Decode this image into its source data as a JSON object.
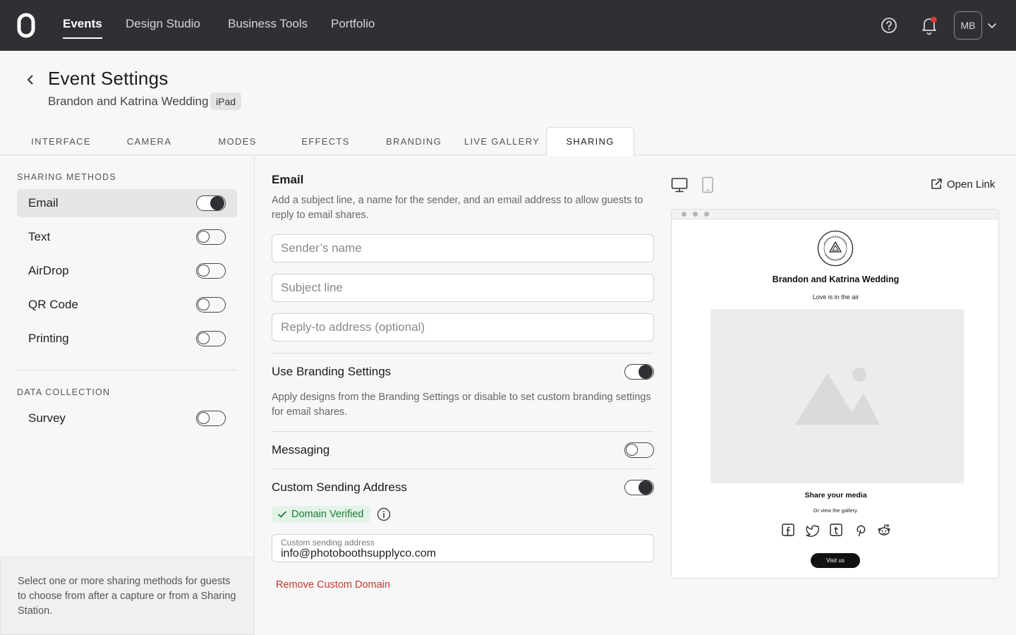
{
  "nav": {
    "items": [
      "Events",
      "Design Studio",
      "Business Tools",
      "Portfolio"
    ],
    "active": "Events",
    "avatar_initials": "MB"
  },
  "header": {
    "title": "Event Settings",
    "event_name": "Brandon and Katrina Wedding",
    "device_badge": "iPad"
  },
  "tabs": [
    "INTERFACE",
    "CAMERA",
    "MODES",
    "EFFECTS",
    "BRANDING",
    "LIVE GALLERY",
    "SHARING"
  ],
  "active_tab": "SHARING",
  "sidebar": {
    "sharing_label": "SHARING METHODS",
    "methods": [
      {
        "label": "Email",
        "on": true,
        "selected": true
      },
      {
        "label": "Text",
        "on": false,
        "selected": false
      },
      {
        "label": "AirDrop",
        "on": false,
        "selected": false
      },
      {
        "label": "QR Code",
        "on": false,
        "selected": false
      },
      {
        "label": "Printing",
        "on": false,
        "selected": false
      }
    ],
    "data_label": "DATA COLLECTION",
    "data_items": [
      {
        "label": "Survey",
        "on": false
      }
    ],
    "help_text": "Select one or more sharing methods for guests to choose from after a capture or from a Sharing Station."
  },
  "email": {
    "title": "Email",
    "description": "Add a subject line, a name for the sender, and an email address to allow guests to reply to email shares.",
    "sender_placeholder": "Sender’s name",
    "subject_placeholder": "Subject line",
    "reply_placeholder": "Reply-to address (optional)",
    "branding_title": "Use Branding Settings",
    "branding_on": true,
    "branding_desc": "Apply designs from the Branding Settings or disable to set custom branding settings for email shares.",
    "messaging_title": "Messaging",
    "messaging_on": false,
    "custom_title": "Custom Sending Address",
    "custom_on": true,
    "verified_label": "Domain Verified",
    "custom_field_label": "Custom sending address",
    "custom_field_value": "info@photoboothsupplyco.com",
    "remove_label": "Remove Custom Domain"
  },
  "preview": {
    "open_link_label": "Open Link",
    "title": "Brandon and Katrina Wedding",
    "subtitle": "Love is in the air",
    "share_title": "Share your media",
    "gallery_text": "Or view the gallery.",
    "visit_label": "Visit us",
    "social_icons": [
      "facebook-icon",
      "twitter-icon",
      "tumblr-icon",
      "pinterest-icon",
      "reddit-icon"
    ]
  },
  "colors": {
    "nav_bg": "#2e3033",
    "accent_dark": "#2e3033",
    "verified_bg": "#e3f3e7",
    "verified_text": "#1c7a3b",
    "danger": "#c0392b"
  }
}
